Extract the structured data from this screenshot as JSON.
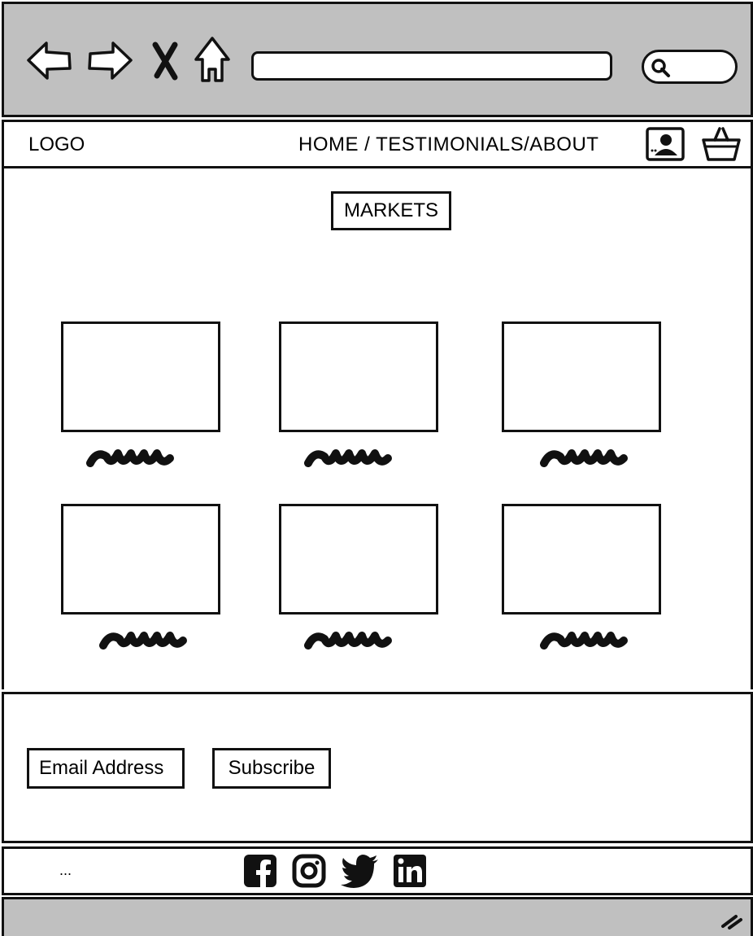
{
  "browser": {
    "back_icon": "arrow-left-icon",
    "forward_icon": "arrow-right-icon",
    "close_icon": "close-icon",
    "home_icon": "home-icon",
    "search_icon": "search-icon",
    "chrome_color": "#c0c0c0"
  },
  "header": {
    "logo": "LOGO",
    "nav_links": "HOME / TESTIMONIALS/ABOUT",
    "account_icon": "account-icon",
    "basket_icon": "basket-icon"
  },
  "main": {
    "markets_label": "MARKETS",
    "items": [
      {
        "name": "image-placeholder"
      },
      {
        "name": "image-placeholder"
      },
      {
        "name": "image-placeholder"
      },
      {
        "name": "image-placeholder"
      },
      {
        "name": "image-placeholder"
      },
      {
        "name": "image-placeholder"
      }
    ]
  },
  "newsletter": {
    "email_placeholder": "Email Address",
    "subscribe_label": "Subscribe"
  },
  "footer": {
    "text": "...",
    "social_icons": [
      "facebook-icon",
      "instagram-icon",
      "twitter-icon",
      "linkedin-icon"
    ]
  }
}
